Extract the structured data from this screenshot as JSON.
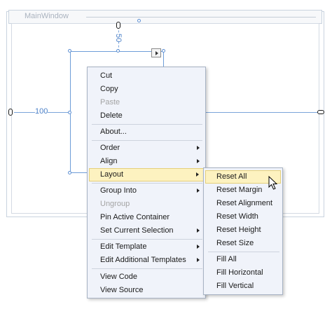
{
  "window": {
    "title": "MainWindow"
  },
  "margins": {
    "top": "50",
    "left": "100"
  },
  "context_menu": {
    "items": [
      {
        "label": "Cut",
        "enabled": true
      },
      {
        "label": "Copy",
        "enabled": true
      },
      {
        "label": "Paste",
        "enabled": false
      },
      {
        "label": "Delete",
        "enabled": true
      },
      {
        "label": "About...",
        "enabled": true
      },
      {
        "label": "Order",
        "enabled": true,
        "submenu": true
      },
      {
        "label": "Align",
        "enabled": true,
        "submenu": true
      },
      {
        "label": "Layout",
        "enabled": true,
        "submenu": true,
        "highlighted": true
      },
      {
        "label": "Group Into",
        "enabled": true,
        "submenu": true
      },
      {
        "label": "Ungroup",
        "enabled": false
      },
      {
        "label": "Pin Active Container",
        "enabled": true
      },
      {
        "label": "Set Current Selection",
        "enabled": true,
        "submenu": true
      },
      {
        "label": "Edit Template",
        "enabled": true,
        "submenu": true
      },
      {
        "label": "Edit Additional Templates",
        "enabled": true,
        "submenu": true
      },
      {
        "label": "View Code",
        "enabled": true
      },
      {
        "label": "View Source",
        "enabled": true
      }
    ]
  },
  "layout_submenu": {
    "items": [
      {
        "label": "Reset All",
        "highlighted": true
      },
      {
        "label": "Reset Margin"
      },
      {
        "label": "Reset Alignment"
      },
      {
        "label": "Reset Width"
      },
      {
        "label": "Reset Height"
      },
      {
        "label": "Reset Size"
      },
      {
        "label": "Fill All"
      },
      {
        "label": "Fill Horizontal"
      },
      {
        "label": "Fill Vertical"
      }
    ]
  },
  "colors": {
    "menu_background": "#f0f3fa",
    "highlight": "#fdf2c0",
    "guide_blue": "#4b80c8"
  }
}
